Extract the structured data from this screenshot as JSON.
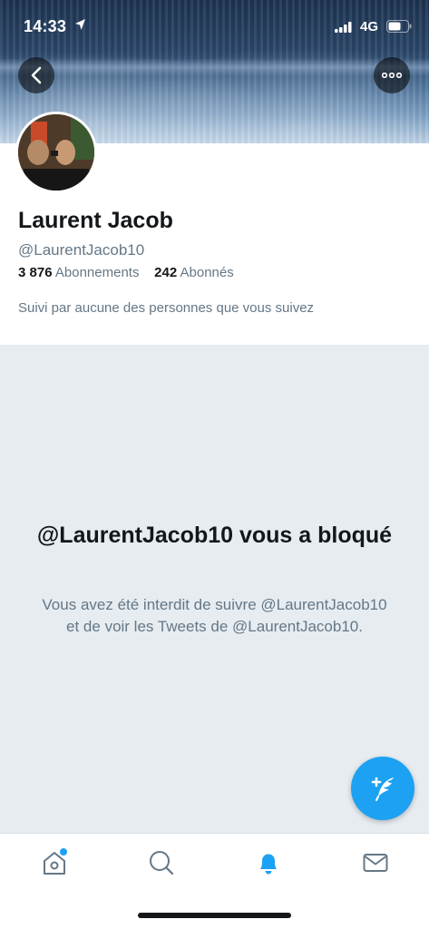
{
  "status_bar": {
    "time": "14:33",
    "network": "4G"
  },
  "profile": {
    "name": "Laurent Jacob",
    "handle": "@LaurentJacob10",
    "following_count": "3 876",
    "following_label": "Abonnements",
    "followers_count": "242",
    "followers_label": "Abonnés",
    "followed_by_text": "Suivi par aucune des personnes que vous suivez"
  },
  "blocked": {
    "title": "@LaurentJacob10 vous a bloqué",
    "description": "Vous avez été interdit de suivre @LaurentJacob10 et de voir les Tweets de @LaurentJacob10."
  },
  "tabs": [
    {
      "icon": "home-icon",
      "active": false,
      "has_dot": true
    },
    {
      "icon": "search-icon",
      "active": false
    },
    {
      "icon": "notifications-icon",
      "active": true
    },
    {
      "icon": "messages-icon",
      "active": false
    }
  ],
  "colors": {
    "accent": "#1da1f2",
    "secondary_text": "#657786",
    "background": "#e6ecf0"
  }
}
